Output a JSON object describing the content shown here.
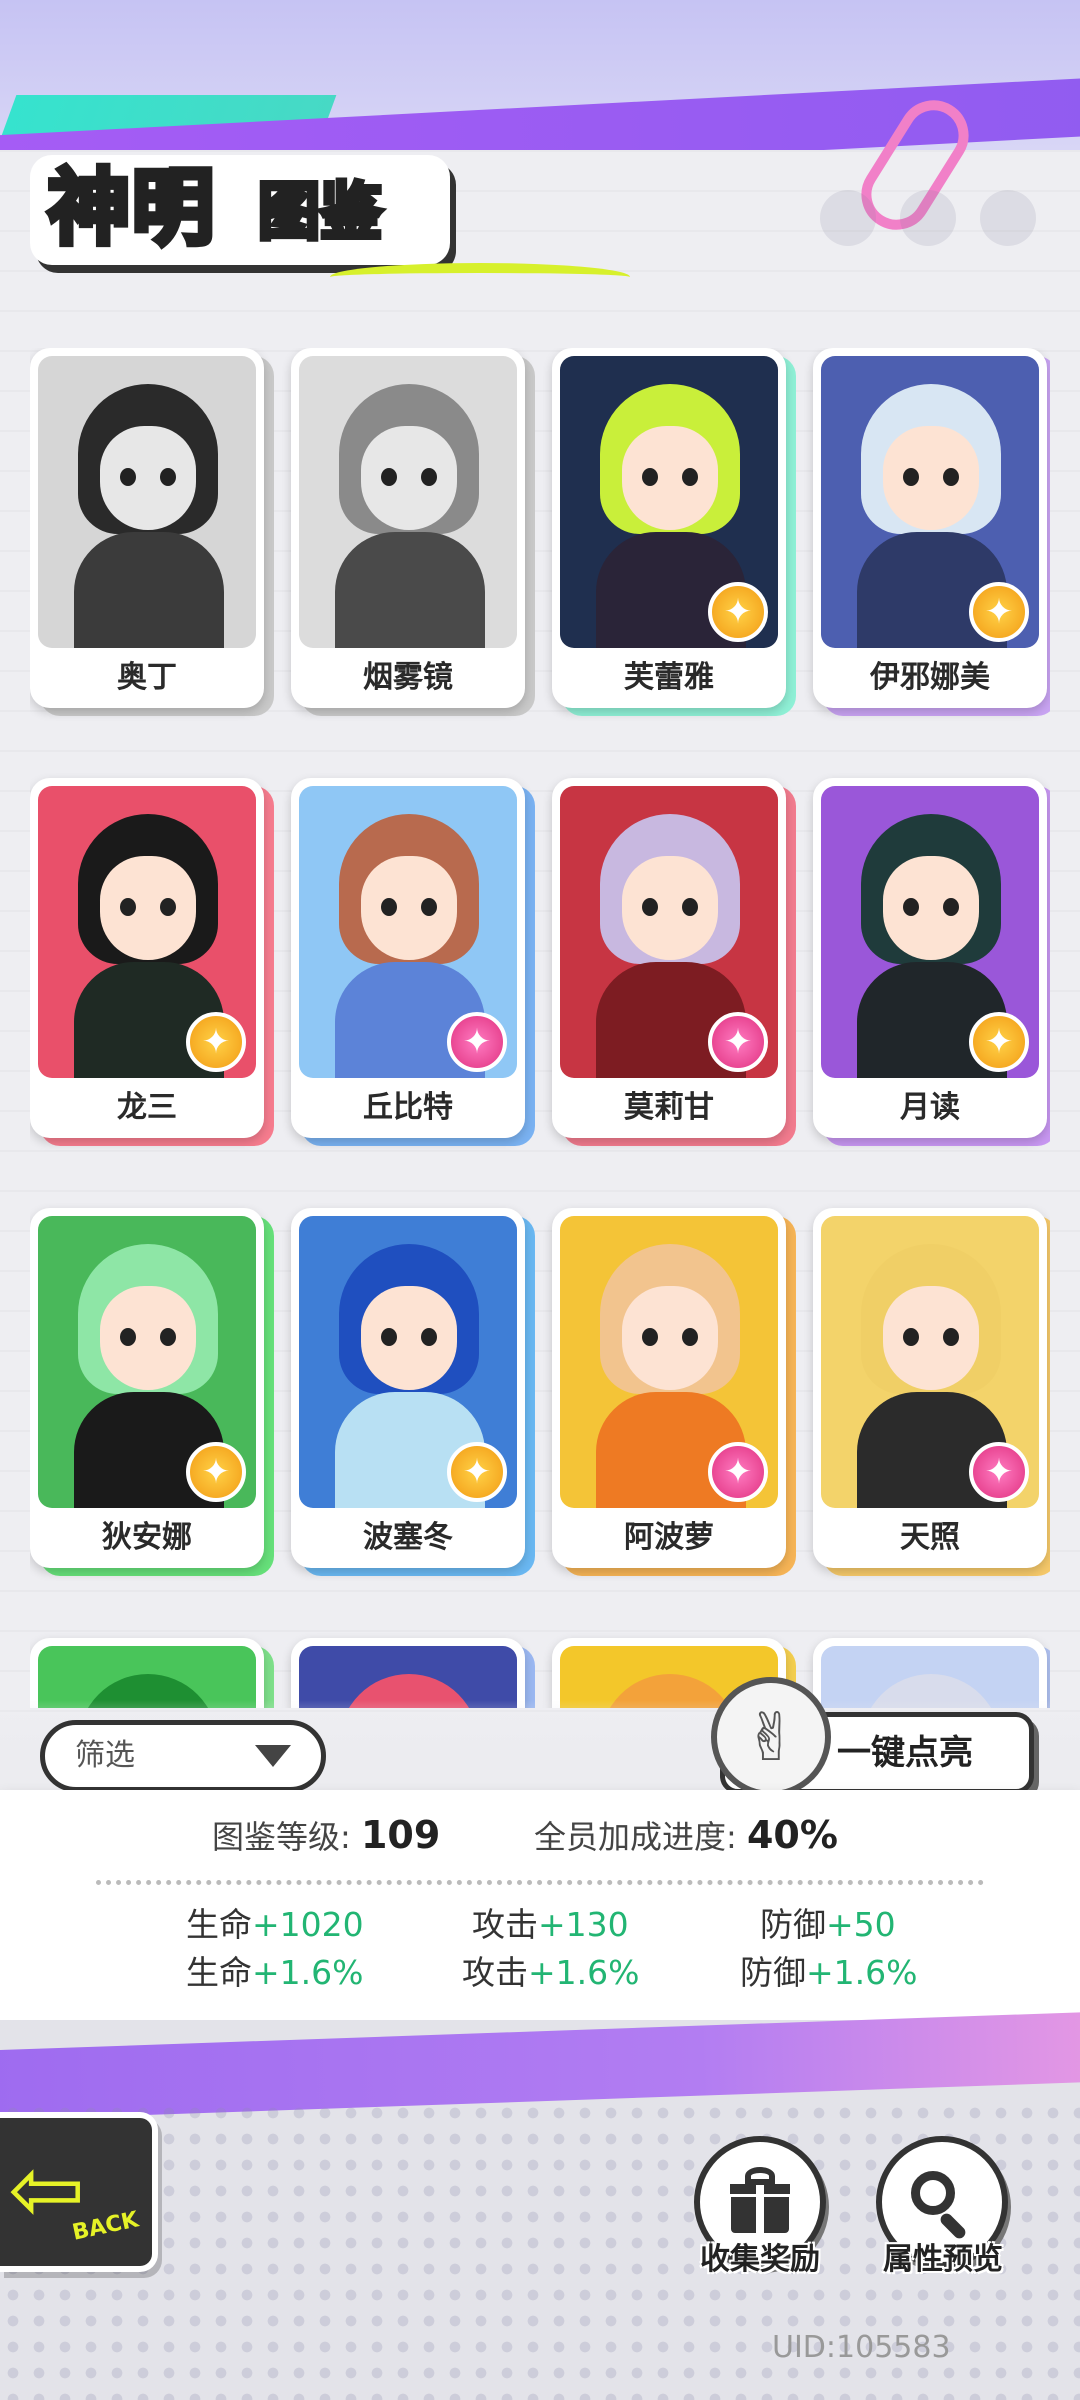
{
  "header": {
    "title_main": "神明",
    "title_sub": "图鉴"
  },
  "cards": [
    {
      "name": "奥丁",
      "locked": true,
      "badge": "none",
      "back": "#c9c9c9",
      "bg": "#d6d6d6",
      "hair": "#2a2a2a",
      "body": "#3b3b3b"
    },
    {
      "name": "烟雾镜",
      "locked": true,
      "badge": "none",
      "back": "#c9c9c9",
      "bg": "#dcdcdc",
      "hair": "#8a8a8a",
      "body": "#4a4a4a"
    },
    {
      "name": "芙蕾雅",
      "locked": false,
      "badge": "gold",
      "back": "#8ff0d6",
      "bg": "#1f2f4f",
      "hair": "#c9ef3a",
      "body": "#2a2438"
    },
    {
      "name": "伊邪娜美",
      "locked": false,
      "badge": "gold",
      "back": "#c9a4f3",
      "bg": "#4d5fb0",
      "hair": "#d8e6f3",
      "body": "#2e3a68"
    },
    {
      "name": "龙三",
      "locked": false,
      "badge": "gold",
      "back": "#f67c8e",
      "bg": "#e9506a",
      "hair": "#1a1a1a",
      "body": "#1f2a24"
    },
    {
      "name": "丘比特",
      "locked": false,
      "badge": "pink",
      "back": "#7ab2f2",
      "bg": "#8fc7f5",
      "hair": "#b86a4e",
      "body": "#5c83d8"
    },
    {
      "name": "莫莉甘",
      "locked": false,
      "badge": "pink",
      "back": "#f27b8e",
      "bg": "#c73543",
      "hair": "#c8b8e0",
      "body": "#7d1c22"
    },
    {
      "name": "月读",
      "locked": false,
      "badge": "gold",
      "back": "#c897f2",
      "bg": "#9a57d9",
      "hair": "#1f3b3b",
      "body": "#20262a"
    },
    {
      "name": "狄安娜",
      "locked": false,
      "badge": "gold",
      "back": "#66e07a",
      "bg": "#49b85a",
      "hair": "#8ee6a6",
      "body": "#1a1a1a"
    },
    {
      "name": "波塞冬",
      "locked": false,
      "badge": "gold",
      "back": "#6ab8f2",
      "bg": "#3f7ed6",
      "hair": "#1f4fbf",
      "body": "#b8e0f3"
    },
    {
      "name": "阿波萝",
      "locked": false,
      "badge": "pink",
      "back": "#f6b456",
      "bg": "#f4c437",
      "hair": "#f2c48e",
      "body": "#ee7a23"
    },
    {
      "name": "天照",
      "locked": false,
      "badge": "pink",
      "back": "#f6c96a",
      "bg": "#f3d36a",
      "hair": "#f0cf66",
      "body": "#2b2b2b"
    },
    {
      "name": "",
      "locked": false,
      "badge": "none",
      "back": "#7ee08a",
      "bg": "#49c55a",
      "hair": "#1e8f32",
      "body": "#2e6f2a"
    },
    {
      "name": "",
      "locked": false,
      "badge": "none",
      "back": "#9bb8f2",
      "bg": "#3f4ba8",
      "hair": "#e8526f",
      "body": "#e6e6f0"
    },
    {
      "name": "",
      "locked": false,
      "badge": "none",
      "back": "#f4cf4f",
      "bg": "#f3c72a",
      "hair": "#f3a23a",
      "body": "#fff3b5"
    },
    {
      "name": "",
      "locked": false,
      "badge": "none",
      "back": "#b0c2f2",
      "bg": "#c4d3f3",
      "hair": "#d8dcec",
      "body": "#8fa6d8"
    }
  ],
  "controls": {
    "filter_label": "筛选",
    "light_all_label": "一键点亮"
  },
  "stats": {
    "level_label": "图鉴等级:",
    "level_value": "109",
    "progress_label": "全员加成进度:",
    "progress_value": "40%",
    "bonuses": [
      {
        "label": "生命",
        "value": "+1020"
      },
      {
        "label": "攻击",
        "value": "+130"
      },
      {
        "label": "防御",
        "value": "+50"
      },
      {
        "label": "生命",
        "value": "+1.6%"
      },
      {
        "label": "攻击",
        "value": "+1.6%"
      },
      {
        "label": "防御",
        "value": "+1.6%"
      }
    ]
  },
  "footer": {
    "back_label": "BACK",
    "collect_reward_label": "收集奖励",
    "attr_preview_label": "属性预览",
    "uid": "UID:105583"
  },
  "colors": {
    "accent_purple": "#a65cf5",
    "bonus_green": "#22b573",
    "title_yellow": "#ffd52e"
  }
}
